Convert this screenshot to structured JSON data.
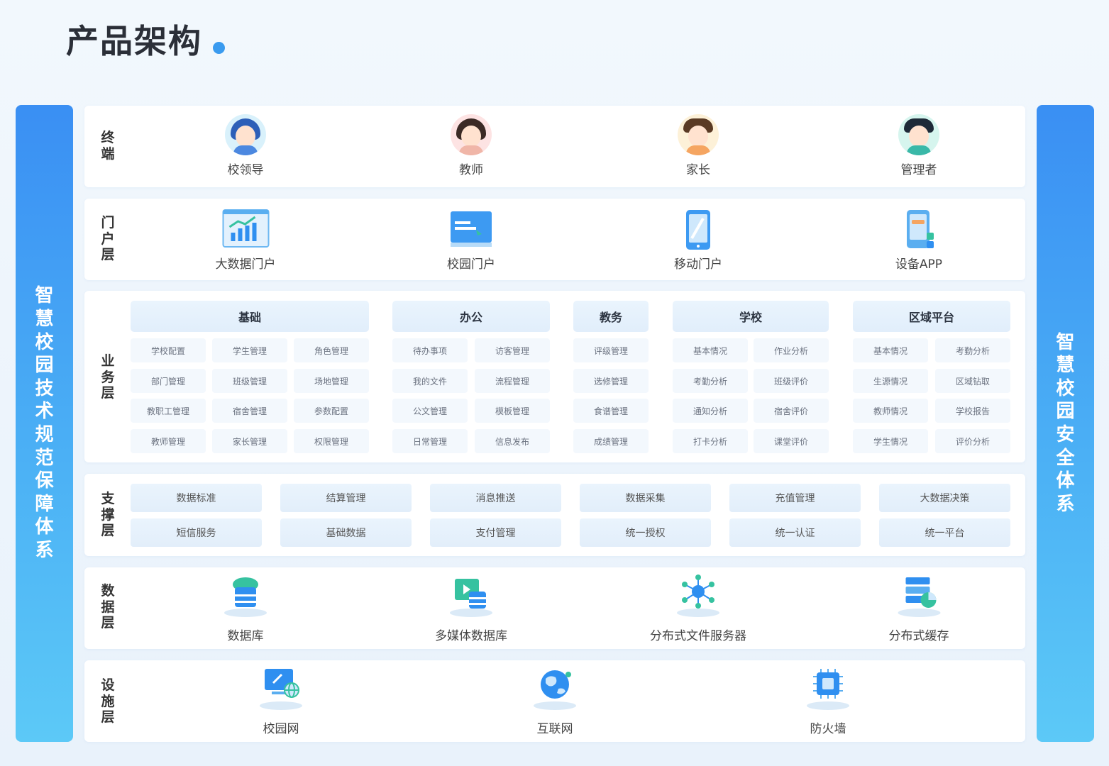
{
  "title": "产品架构",
  "left_pillar": "智慧校园技术规范保障体系",
  "right_pillar": "智慧校园安全体系",
  "colors": {
    "accent": "#3a9bef",
    "pillar_top": "#3a8ff3",
    "pillar_bottom": "#5cc9f7"
  },
  "terminal": {
    "label": "终端",
    "items": [
      {
        "label": "校领导",
        "icon": "female-leader-avatar-icon"
      },
      {
        "label": "教师",
        "icon": "female-teacher-avatar-icon"
      },
      {
        "label": "家长",
        "icon": "parent-avatar-icon"
      },
      {
        "label": "管理者",
        "icon": "admin-avatar-icon"
      }
    ]
  },
  "portal": {
    "label": "门户层",
    "items": [
      {
        "label": "大数据门户",
        "icon": "bar-chart-dashboard-icon"
      },
      {
        "label": "校园门户",
        "icon": "monitor-icon"
      },
      {
        "label": "移动门户",
        "icon": "mobile-phone-icon"
      },
      {
        "label": "设备APP",
        "icon": "device-app-icon"
      }
    ]
  },
  "business": {
    "label": "业务层",
    "groups": [
      {
        "name": "基础",
        "items": [
          "学校配置",
          "学生管理",
          "角色管理",
          "部门管理",
          "班级管理",
          "场地管理",
          "教职工管理",
          "宿舍管理",
          "参数配置",
          "教师管理",
          "家长管理",
          "权限管理"
        ]
      },
      {
        "name": "办公",
        "items": [
          "待办事项",
          "访客管理",
          "我的文件",
          "流程管理",
          "公文管理",
          "模板管理",
          "日常管理",
          "信息发布"
        ]
      },
      {
        "name": "教务",
        "items": [
          "评级管理",
          "选修管理",
          "食谱管理",
          "成绩管理"
        ]
      },
      {
        "name": "学校",
        "items": [
          "基本情况",
          "作业分析",
          "考勤分析",
          "班级评价",
          "通知分析",
          "宿舍评价",
          "打卡分析",
          "课堂评价"
        ]
      },
      {
        "name": "区域平台",
        "items": [
          "基本情况",
          "考勤分析",
          "生源情况",
          "区域钻取",
          "教师情况",
          "学校报告",
          "学生情况",
          "评价分析"
        ]
      }
    ]
  },
  "support": {
    "label": "支撑层",
    "items": [
      "数据标准",
      "结算管理",
      "消息推送",
      "数据采集",
      "充值管理",
      "大数据决策",
      "短信服务",
      "基础数据",
      "支付管理",
      "统一授权",
      "统一认证",
      "统一平台"
    ]
  },
  "data_layer": {
    "label": "数据层",
    "items": [
      {
        "label": "数据库",
        "icon": "database-cloud-icon"
      },
      {
        "label": "多媒体数据库",
        "icon": "multimedia-database-icon"
      },
      {
        "label": "分布式文件服务器",
        "icon": "network-node-icon"
      },
      {
        "label": "分布式缓存",
        "icon": "cache-server-icon"
      }
    ]
  },
  "infra": {
    "label": "设施层",
    "items": [
      {
        "label": "校园网",
        "icon": "campus-network-computer-icon"
      },
      {
        "label": "互联网",
        "icon": "globe-icon"
      },
      {
        "label": "防火墙",
        "icon": "firewall-chip-icon"
      }
    ]
  }
}
